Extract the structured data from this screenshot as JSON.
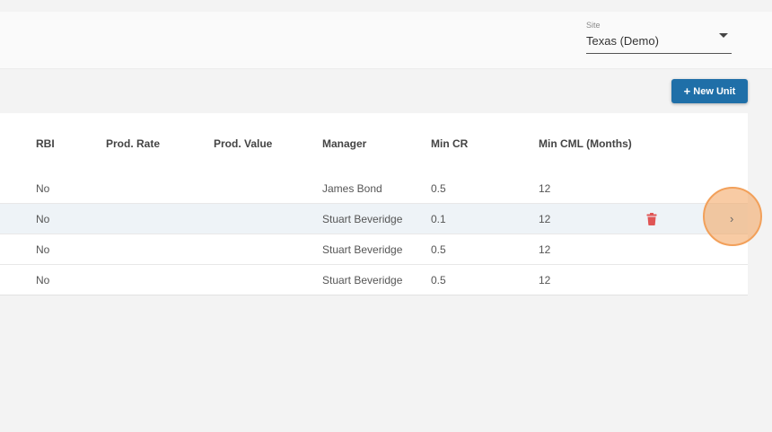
{
  "header": {
    "site_label": "Site",
    "site_value": "Texas (Demo)"
  },
  "toolbar": {
    "new_unit_label": "New Unit"
  },
  "table": {
    "columns": [
      "RBI",
      "Prod. Rate",
      "Prod. Value",
      "Manager",
      "Min CR",
      "Min CML (Months)"
    ],
    "rows": [
      {
        "rbi": "No",
        "prod_rate": "",
        "prod_value": "",
        "manager": "James Bond",
        "min_cr": "0.5",
        "min_cml": "12"
      },
      {
        "rbi": "No",
        "prod_rate": "",
        "prod_value": "",
        "manager": "Stuart Beveridge",
        "min_cr": "0.1",
        "min_cml": "12"
      },
      {
        "rbi": "No",
        "prod_rate": "",
        "prod_value": "",
        "manager": "Stuart Beveridge",
        "min_cr": "0.5",
        "min_cml": "12"
      },
      {
        "rbi": "No",
        "prod_rate": "",
        "prod_value": "",
        "manager": "Stuart Beveridge",
        "min_cr": "0.5",
        "min_cml": "12"
      }
    ]
  },
  "icons": {
    "trash": "trash-icon",
    "chevron": "chevron-right-icon"
  },
  "colors": {
    "primary_button": "#1f6fa8",
    "delete_icon": "#e05555",
    "highlight_row": "#eef3f7",
    "click_marker": "#f2a05a"
  }
}
